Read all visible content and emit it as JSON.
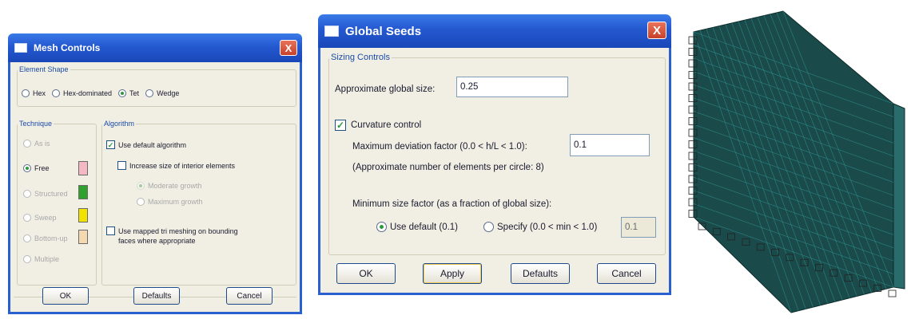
{
  "mesh_controls": {
    "title": "Mesh Controls",
    "close": "X",
    "element_shape": {
      "legend": "Element Shape",
      "options": [
        "Hex",
        "Hex-dominated",
        "Tet",
        "Wedge"
      ],
      "selected": "Tet"
    },
    "technique": {
      "legend": "Technique",
      "options": [
        "As is",
        "Free",
        "Structured",
        "Sweep",
        "Bottom-up",
        "Multiple"
      ],
      "selected": "Free",
      "swatch_colors": [
        "#f3b8c4",
        "#2fa12f",
        "#f2e200",
        "#f4d9b0"
      ]
    },
    "algorithm": {
      "legend": "Algorithm",
      "use_default": "Use default algorithm",
      "increase_size": "Increase size of interior elements",
      "moderate_growth": "Moderate growth",
      "maximum_growth": "Maximum growth",
      "use_mapped_line1": "Use mapped tri meshing on bounding",
      "use_mapped_line2": "faces where appropriate"
    },
    "buttons": {
      "ok": "OK",
      "defaults": "Defaults",
      "cancel": "Cancel"
    }
  },
  "global_seeds": {
    "title": "Global Seeds",
    "close": "X",
    "sizing_legend": "Sizing Controls",
    "approx_label": "Approximate global size:",
    "approx_value": "0.25",
    "curvature_label": "Curvature control",
    "curvature_checked": true,
    "max_dev_label": "Maximum deviation factor (0.0 < h/L < 1.0):",
    "max_dev_value": "0.1",
    "approx_elements": "(Approximate number of elements per circle: 8)",
    "min_size_label": "Minimum size factor (as a fraction of global size):",
    "use_default_label": "Use default (0.1)",
    "specify_label": "Specify (0.0 < min < 1.0)",
    "specify_value": "0.1",
    "buttons": {
      "ok": "OK",
      "apply": "Apply",
      "defaults": "Defaults",
      "cancel": "Cancel"
    }
  },
  "mesh_view": {
    "colors": {
      "mesh": "#1b4a4a",
      "edge": "#2f9e9e"
    }
  }
}
